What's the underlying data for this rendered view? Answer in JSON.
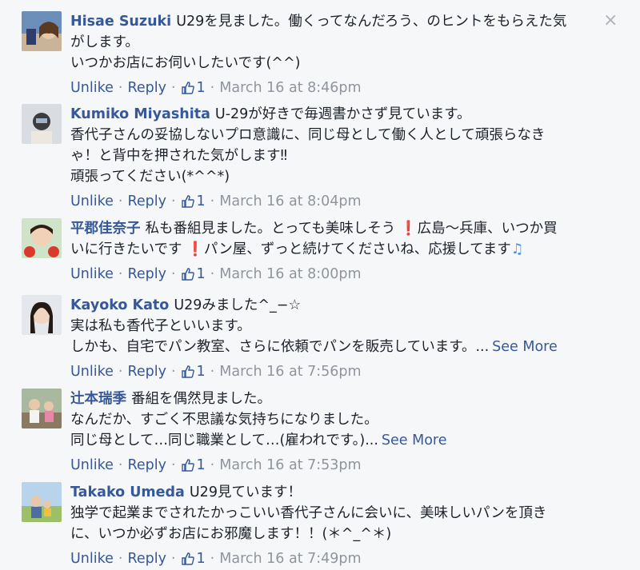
{
  "actions": {
    "unlike": "Unlike",
    "reply": "Reply",
    "separator": "·"
  },
  "close_icon": "×",
  "comments": [
    {
      "author": "Hisae Suzuki",
      "lines": [
        "U29を見ました。働くってなんだろう、のヒントをもらえた気",
        "がします。",
        "いつかお店にお伺いしたいです(^^)"
      ],
      "likes": "1",
      "time": "March 16 at 8:46pm"
    },
    {
      "author": "Kumiko Miyashita",
      "lines": [
        "U-29が好きで毎週書かさず見ています。",
        "香代子さんの妥協しないプロ意識に、同じ母として働く人として頑張らなき",
        "ゃ！と背中を押された気がします‼",
        "頑張ってください(*^^*)"
      ],
      "likes": "1",
      "time": "March 16 at 8:04pm"
    },
    {
      "author": "平郡佳奈子",
      "lines": [
        "私も番組見ました。とっても美味しそう ",
        "広島〜兵庫、いつか買",
        "いに行きたいです ",
        "パン屋、ずっと続けてくださいね、応援してます"
      ],
      "likes": "1",
      "time": "March 16 at 8:00pm"
    },
    {
      "author": "Kayoko Kato",
      "lines": [
        "U29みました^_−☆",
        "実は私も香代子といいます。",
        "しかも、自宅でパン教室、さらに依頼でパンを販売しています。..."
      ],
      "see_more": "See More",
      "likes": "1",
      "time": "March 16 at 7:56pm"
    },
    {
      "author": "辻本瑞季",
      "lines": [
        "番組を偶然見ました。",
        "なんだか、すごく不思議な気持ちになりました。",
        "同じ母として…同じ職業として…(雇われです。)..."
      ],
      "see_more": "See More",
      "likes": "1",
      "time": "March 16 at 7:53pm"
    },
    {
      "author": "Takako Umeda",
      "lines": [
        "U29見ています！",
        "独学で起業までされたかっこいい香代子さんに会いに、美味しいパンを頂き",
        "に、いつか必ずお店にお邪魔します！！(＊^_^＊)"
      ],
      "likes": "1",
      "time": "March 16 at 7:49pm"
    }
  ],
  "colors": {
    "link": "#365899",
    "meta": "#90949c",
    "text": "#1d2129",
    "background": "#f6f7f9"
  }
}
